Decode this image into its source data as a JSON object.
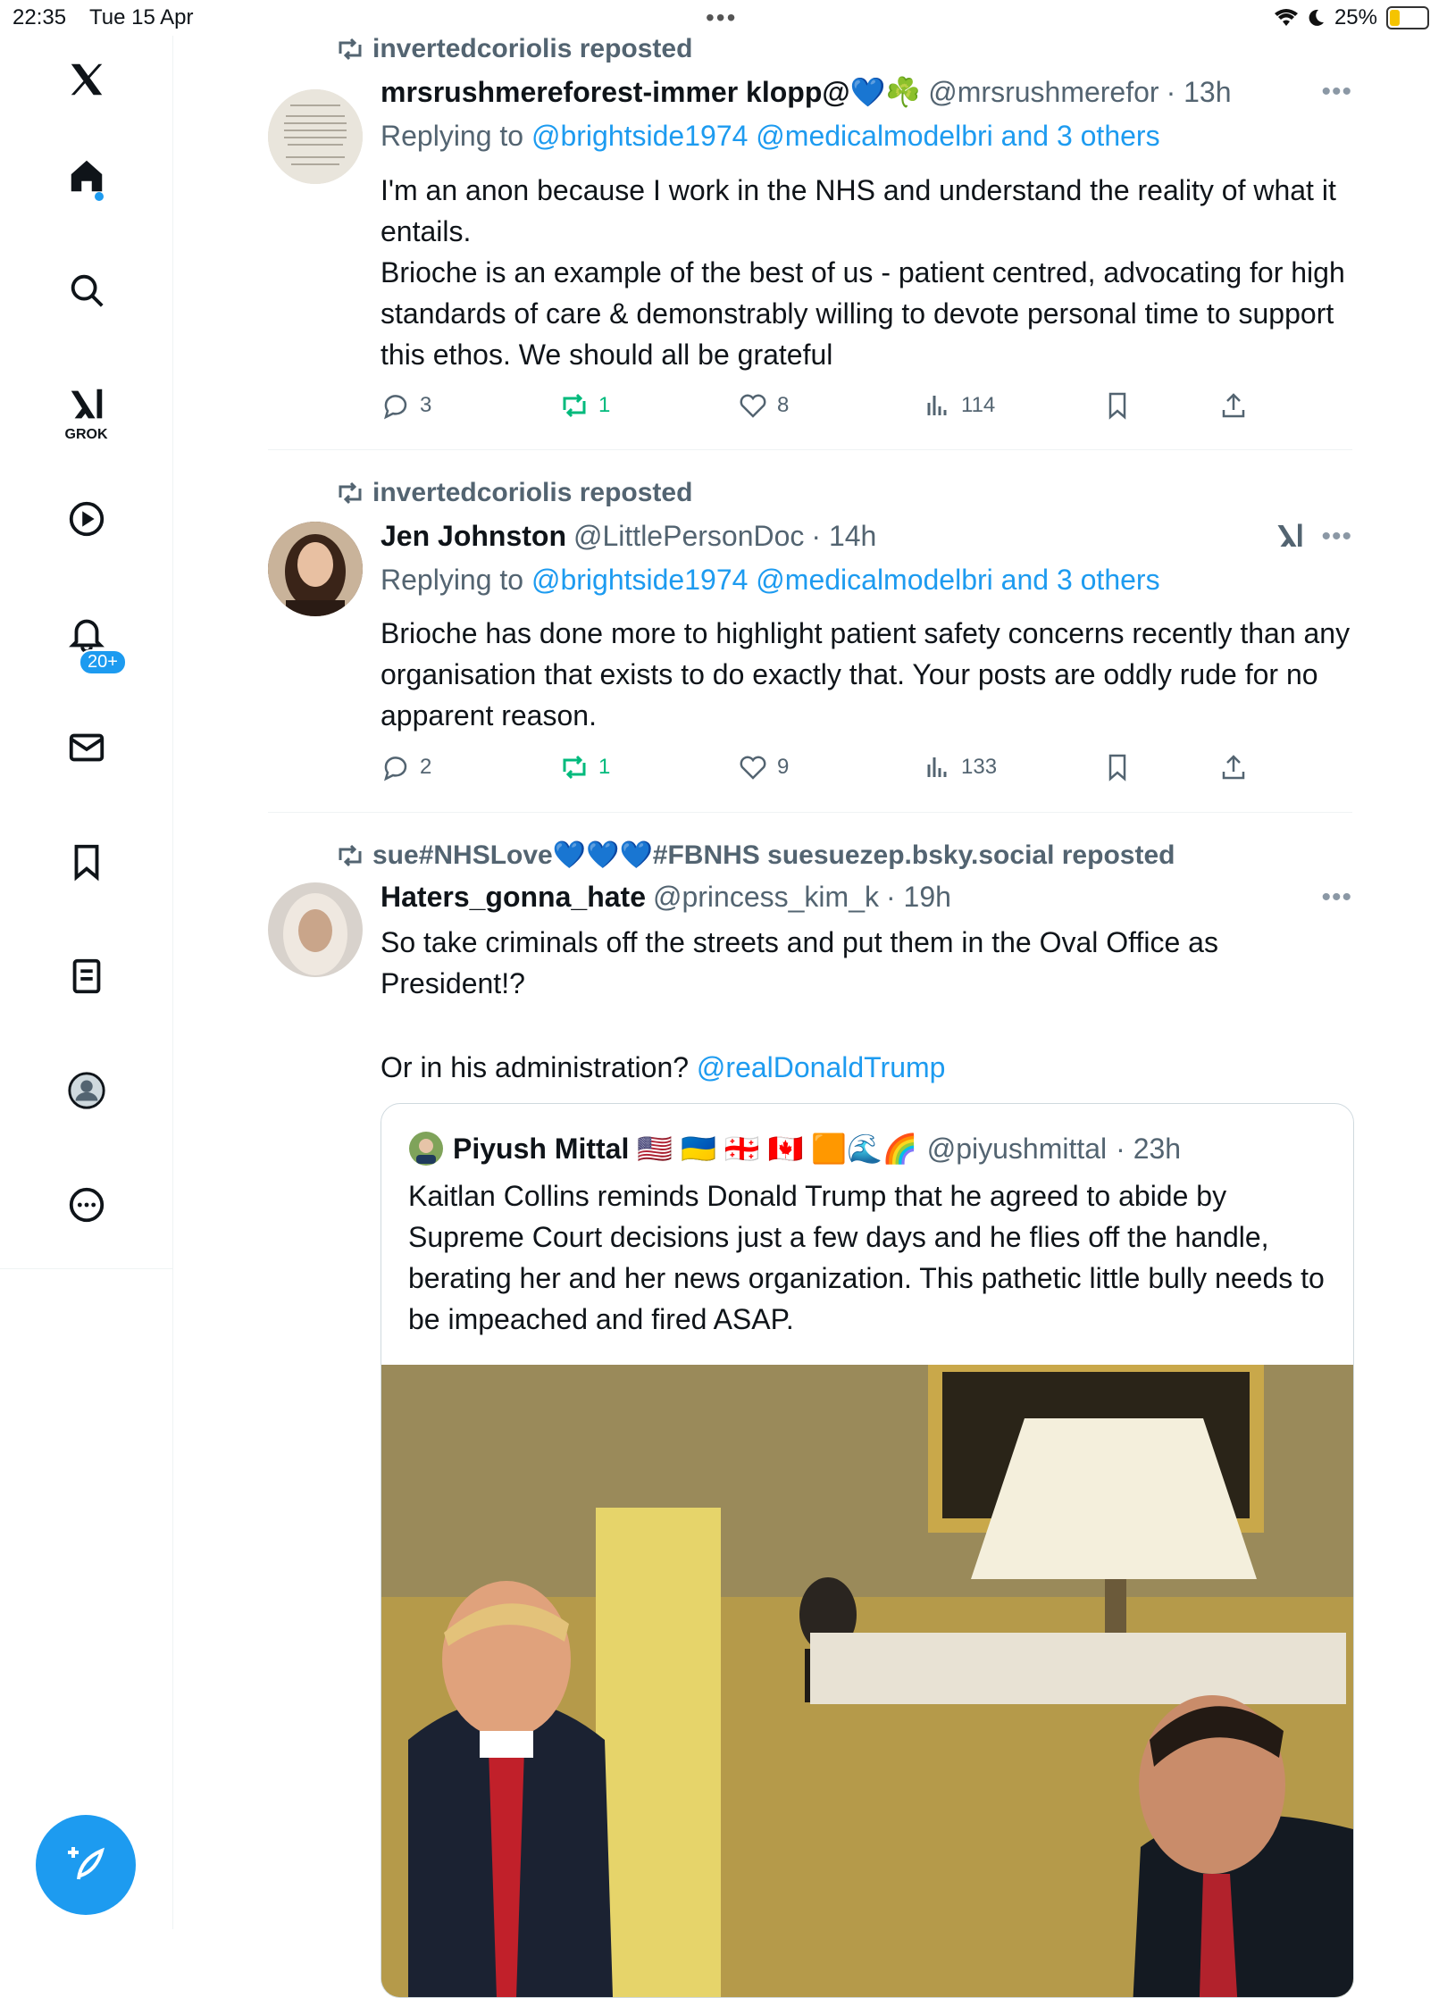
{
  "status_bar": {
    "time": "22:35",
    "date": "Tue 15 Apr",
    "battery": "25%"
  },
  "sidebar": {
    "grok_label": "GROK",
    "notifications_badge": "20+",
    "icons": [
      "x-logo-icon",
      "home-icon",
      "search-icon",
      "grok-icon",
      "video-icon",
      "bell-icon",
      "mail-icon",
      "bookmark-icon",
      "list-icon",
      "profile-icon",
      "more-icon",
      "compose-icon"
    ]
  },
  "tweets": [
    {
      "reposted_by": "invertedcoriolis reposted",
      "author": "mrsrushmereforest-immer klopp@💙☘️",
      "handle": "@mrsrushmerefor",
      "time": "· 13h",
      "replying_prefix": "Replying to",
      "replying_to": "@brightside1974 @medicalmodelbri and 3 others",
      "text": "I'm an anon because I work in the NHS and understand the reality of what it entails.\nBrioche is an example of the best of us - patient centred, advocating for high standards of care & demonstrably willing to devote personal time to support this ethos. We should all be grateful",
      "replies": "3",
      "reposts": "1",
      "likes": "8",
      "views": "114"
    },
    {
      "reposted_by": "invertedcoriolis reposted",
      "author": "Jen Johnston",
      "handle": "@LittlePersonDoc",
      "time": "· 14h",
      "replying_prefix": "Replying to",
      "replying_to": "@brightside1974 @medicalmodelbri and 3 others",
      "text": "Brioche has done more to highlight patient safety concerns recently than any organisation that exists to do exactly that. Your posts are oddly rude for no apparent reason.",
      "replies": "2",
      "reposts": "1",
      "likes": "9",
      "views": "133"
    },
    {
      "reposted_by": "sue#NHSLove💙💙💙#FBNHS suesuezep.bsky.social reposted",
      "author": "Haters_gonna_hate",
      "handle": "@princess_kim_k",
      "time": "· 19h",
      "text": "So take criminals off the streets and put them in the Oval Office as President!?",
      "text2": "Or in his administration?",
      "mention": "@realDonaldTrump",
      "quote": {
        "author": "Piyush Mittal 🇺🇸 🇺🇦 🇬🇪 🇨🇦 🟧🌊🌈",
        "handle": "@piyushmittal",
        "time": "· 23h",
        "text": "Kaitlan Collins reminds Donald Trump that he agreed to abide by Supreme Court decisions just a few days and he flies off the handle, berating her and her news organization. This pathetic little bully needs to be impeached and fired ASAP."
      }
    }
  ],
  "colors": {
    "accent": "#1d9bf0",
    "repost_green": "#00ba7c",
    "muted": "#536471"
  }
}
